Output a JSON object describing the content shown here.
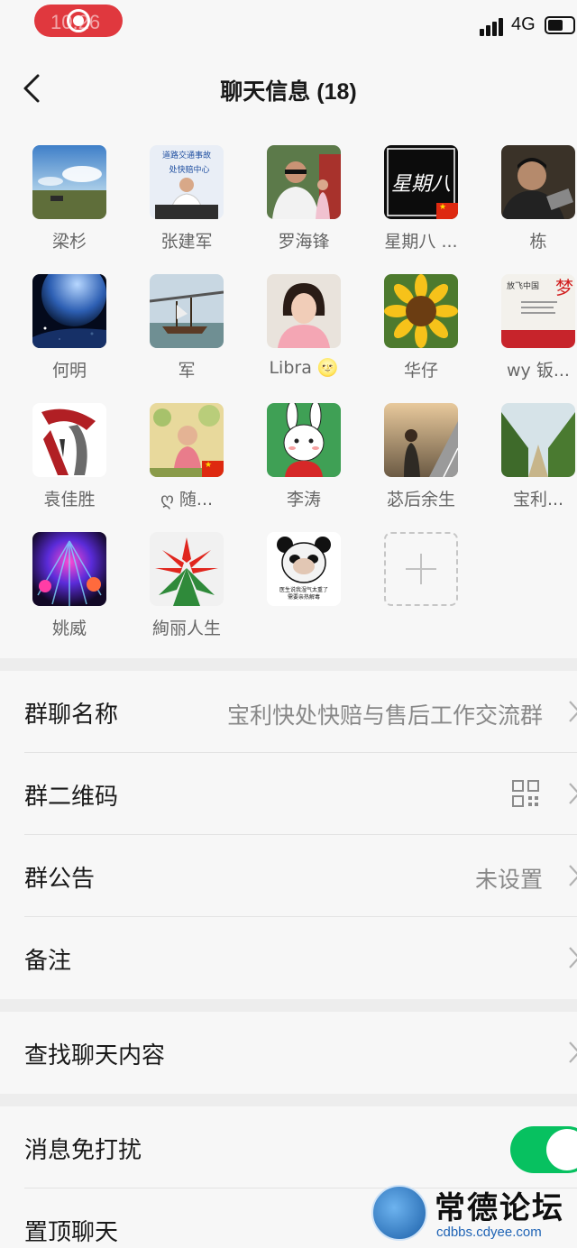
{
  "status_bar": {
    "time": "10:26",
    "network": "4G"
  },
  "nav": {
    "title": "聊天信息 (18)"
  },
  "members": [
    {
      "name": "梁杉"
    },
    {
      "name": "张建军"
    },
    {
      "name": "罗海锋"
    },
    {
      "name": "星期八 ..."
    },
    {
      "name": "栋"
    },
    {
      "name": "何明"
    },
    {
      "name": "军"
    },
    {
      "name": "Libra 🌝"
    },
    {
      "name": "华仔"
    },
    {
      "name": "wy 钣..."
    },
    {
      "name": "袁佳胜"
    },
    {
      "name": "ღ 随..."
    },
    {
      "name": "李涛"
    },
    {
      "name": "苾后余生"
    },
    {
      "name": "宝利..."
    },
    {
      "name": "姚威"
    },
    {
      "name": "絢丽人生"
    },
    {
      "name": ""
    }
  ],
  "avatar_text": {
    "banner_top": "道路交通事故",
    "banner_bottom": "处快赔中心",
    "calligraphy": "星期八",
    "dream_title": "放飞中国",
    "dream_char": "梦",
    "meme_line1": "医生说我湿气太重了",
    "meme_line2": "需要亲热解毒"
  },
  "settings": {
    "group_name_label": "群聊名称",
    "group_name_value": "宝利快处快赔与售后工作交流群",
    "qr_label": "群二维码",
    "notice_label": "群公告",
    "notice_value": "未设置",
    "remark_label": "备注",
    "search_label": "查找聊天内容",
    "mute_label": "消息免打扰",
    "mute_on": true,
    "pin_label": "置顶聊天"
  },
  "watermark": {
    "title": "常德论坛",
    "url": "cdbbs.cdyee.com"
  },
  "colors": {
    "accent_green": "#07c160",
    "record_red": "#e0383e",
    "background": "#ededed",
    "panel": "#f7f7f7"
  }
}
